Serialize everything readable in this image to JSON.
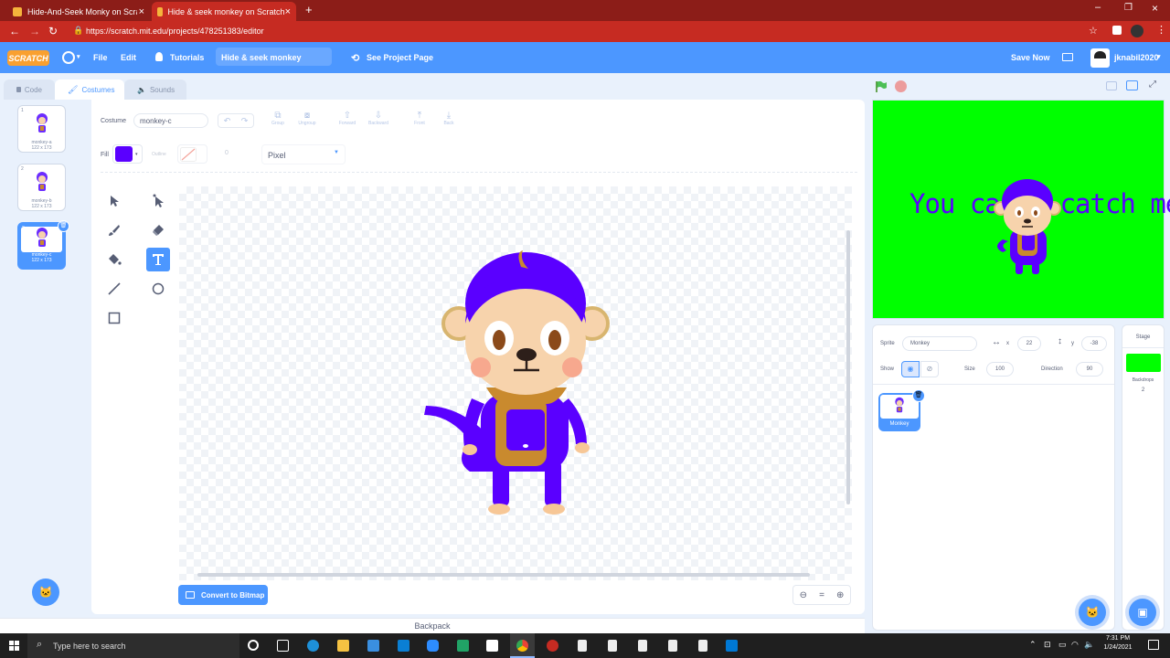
{
  "browser": {
    "tabs": [
      {
        "title": "Hide-And-Seek Monky on Scratch"
      },
      {
        "title": "Hide & seek monkey on Scratch"
      }
    ],
    "url": "https://scratch.mit.edu/projects/478251383/editor"
  },
  "menubar": {
    "logo": "SCRATCH",
    "file": "File",
    "edit": "Edit",
    "tutorials": "Tutorials",
    "project_title": "Hide & seek monkey",
    "see_project": "See Project Page",
    "save_now": "Save Now",
    "username": "jknabil2020"
  },
  "editor_tabs": {
    "code": "Code",
    "costumes": "Costumes",
    "sounds": "Sounds"
  },
  "costumes": [
    {
      "num": "1",
      "name": "monkey-a",
      "size": "122 x 173"
    },
    {
      "num": "2",
      "name": "monkey-b",
      "size": "122 x 173"
    },
    {
      "num": "3",
      "name": "monkey-c",
      "size": "122 x 173"
    }
  ],
  "paint": {
    "costume_label": "Costume",
    "costume_name": "monkey-c",
    "group": "Group",
    "ungroup": "Ungroup",
    "forward": "Forward",
    "backward": "Backward",
    "front": "Front",
    "back": "Back",
    "fill_label": "Fill",
    "outline_label": "Outline",
    "outline_value": "0",
    "font": "Pixel",
    "convert_button": "Convert to Bitmap",
    "fill_color": "#5a00ff"
  },
  "stage": {
    "text": "You can't catch me!"
  },
  "sprite_info": {
    "sprite_label": "Sprite",
    "sprite_name": "Monkey",
    "x_label": "x",
    "x_value": "22",
    "y_label": "y",
    "y_value": "-38",
    "show_label": "Show",
    "size_label": "Size",
    "size_value": "100",
    "direction_label": "Direction",
    "direction_value": "90",
    "sprite_tile_name": "Monkey"
  },
  "stage_panel": {
    "label": "Stage",
    "backdrops_label": "Backdrops",
    "backdrops_count": "2"
  },
  "backpack": "Backpack",
  "taskbar": {
    "search": "Type here to search",
    "time": "7:31 PM",
    "date": "1/24/2021"
  }
}
